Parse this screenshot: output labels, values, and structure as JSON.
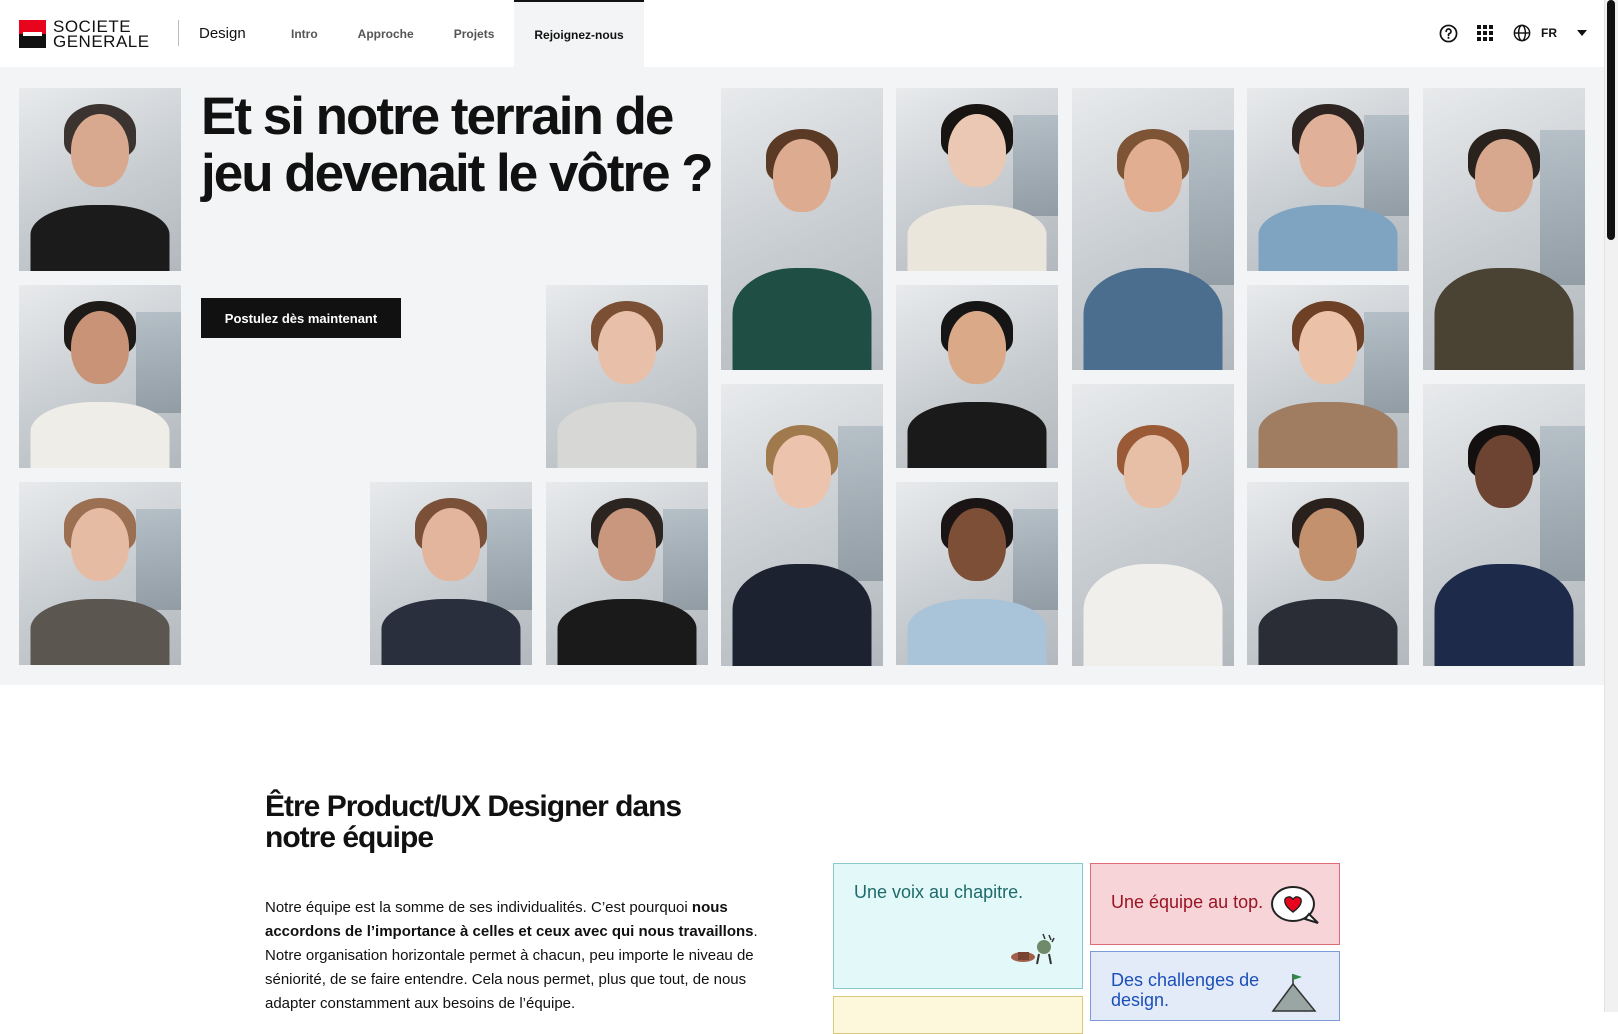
{
  "brand": {
    "logo_line1": "SOCIETE",
    "logo_line2": "GENERALE",
    "section_label": "Design",
    "colors": {
      "red": "#e9041e",
      "black": "#111111"
    }
  },
  "nav": {
    "items": [
      {
        "label": "Intro",
        "active": false
      },
      {
        "label": "Approche",
        "active": false
      },
      {
        "label": "Projets",
        "active": false
      },
      {
        "label": "Rejoignez-nous",
        "active": true
      }
    ]
  },
  "header_right": {
    "help_icon": "help-circle-icon",
    "apps_icon": "grid-icon",
    "globe_icon": "globe-icon",
    "language": "FR",
    "dropdown_icon": "caret-down-icon"
  },
  "hero": {
    "title": "Et si notre terrain de jeu devenait le vôtre ?",
    "cta_label": "Postulez dès maintenant",
    "background": "#f3f4f5"
  },
  "section": {
    "title": "Être Product/UX Designer dans notre équipe",
    "paragraph_part1": "Notre équipe est la somme de ses individualités. C’est pourquoi ",
    "paragraph_bold1": "nous accordons de l’importance à celles et ceux avec qui nous travaillons",
    "paragraph_part2": ". Notre organisation horizontale permet à chacun, peu importe le niveau de séniorité, de se faire entendre. Cela nous permet, plus que tout, de nous adapter constamment aux besoins de l’équipe."
  },
  "cards": [
    {
      "label": "Une voix au chapitre.",
      "icon": "megaphone-sticker-icon",
      "color": "#1d6b6b"
    },
    {
      "label": "Une équipe au top.",
      "icon": "heart-bubble-sticker-icon",
      "color": "#9a1424"
    },
    {
      "label": "Des challenges de design.",
      "icon": "mountain-flag-sticker-icon",
      "color": "#1b4fb8"
    },
    {
      "label": "",
      "icon": "",
      "color": "#d9c77a"
    }
  ]
}
